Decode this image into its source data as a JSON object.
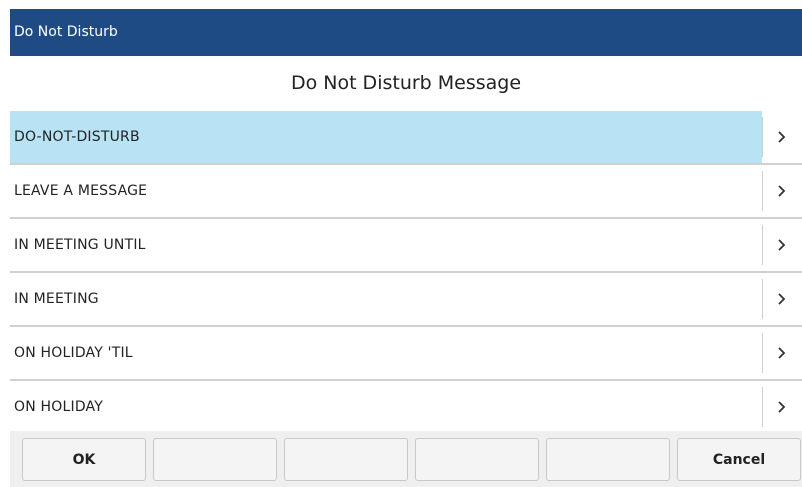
{
  "window": {
    "title": "Do Not Disturb"
  },
  "heading": "Do Not Disturb Message",
  "items": [
    {
      "label": "DO-NOT-DISTURB",
      "selected": true
    },
    {
      "label": "LEAVE A MESSAGE",
      "selected": false
    },
    {
      "label": "IN MEETING UNTIL",
      "selected": false
    },
    {
      "label": "IN MEETING",
      "selected": false
    },
    {
      "label": "ON HOLIDAY 'TIL",
      "selected": false
    },
    {
      "label": "ON HOLIDAY",
      "selected": false
    }
  ],
  "softkeys": [
    "OK",
    "",
    "",
    "",
    "",
    "Cancel"
  ],
  "icons": {
    "row_arrow": "chevron-right-icon"
  },
  "colors": {
    "titlebar": "#1f4b85",
    "selected_row": "#b7e3f5"
  }
}
